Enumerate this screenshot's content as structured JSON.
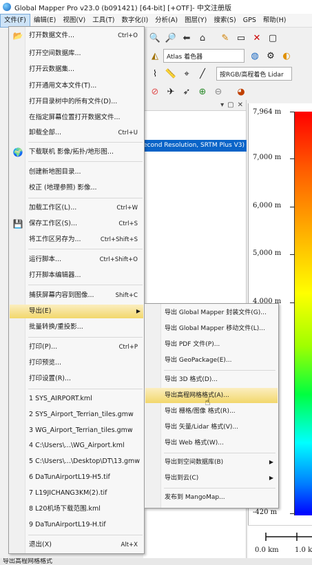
{
  "window": {
    "title": "Global Mapper Pro v23.0 (b091421) [64-bit] [+OTF]- 中文注册版"
  },
  "menubar": [
    {
      "label": "文件(F)",
      "active": true
    },
    {
      "label": "编辑(E)"
    },
    {
      "label": "视图(V)"
    },
    {
      "label": "工具(T)"
    },
    {
      "label": "数字化(I)"
    },
    {
      "label": "分析(A)"
    },
    {
      "label": "图层(Y)"
    },
    {
      "label": "搜索(S)"
    },
    {
      "label": "GPS"
    },
    {
      "label": "帮助(H)"
    }
  ],
  "toolbar": {
    "basemap_select": "Atlas 着色器",
    "shader_select": "按RGB/高程着色 Lidar"
  },
  "layer_panel": {
    "selected_layer": "econd Resolution, SRTM Plus V3)"
  },
  "file_menu": {
    "items": [
      {
        "label": "打开数据文件...",
        "shortcut": "Ctrl+O",
        "icon": "folder-icon"
      },
      {
        "label": "打开空间数据库..."
      },
      {
        "label": "打开云数据集..."
      },
      {
        "label": "打开通用文本文件(T)..."
      },
      {
        "label": "打开目录树中的所有文件(D)..."
      },
      {
        "label": "在指定屏幕位置打开数据文件..."
      },
      {
        "label": "卸载全部...",
        "shortcut": "Ctrl+U"
      },
      {
        "label": "下载联机 影像/拓扑/地形图...",
        "icon": "globe-icon"
      },
      {
        "label": "创建新地图目录..."
      },
      {
        "label": "校正 (地理参照) 影像..."
      },
      {
        "label": "加载工作区(L)...",
        "shortcut": "Ctrl+W"
      },
      {
        "label": "保存工作区(S)...",
        "shortcut": "Ctrl+S",
        "icon": "save-icon"
      },
      {
        "label": "将工作区另存为...",
        "shortcut": "Ctrl+Shift+S"
      },
      {
        "label": "运行脚本...",
        "shortcut": "Ctrl+Shift+O"
      },
      {
        "label": "打开脚本编辑器..."
      },
      {
        "label": "捕获屏幕内容到图像...",
        "shortcut": "Shift+C"
      },
      {
        "label": "导出(E)",
        "submenu": true
      },
      {
        "label": "批量转换/重投影..."
      },
      {
        "label": "打印(P)...",
        "shortcut": "Ctrl+P"
      },
      {
        "label": "打印预览..."
      },
      {
        "label": "打印设置(R)..."
      },
      {
        "label": "1 SYS_AIRPORT.kml"
      },
      {
        "label": "2 SYS_Airport_Terrian_tiles.gmw"
      },
      {
        "label": "3 WG_Airport_Terrian_tiles.gmw"
      },
      {
        "label": "4 C:\\Users\\...\\WG_Airport.kml"
      },
      {
        "label": "5 C:\\Users\\...\\Desktop\\DT\\13.gmw"
      },
      {
        "label": "6 DaTunAirportL19-H5.tif"
      },
      {
        "label": "7 L19JICHANG3KM(2).tif"
      },
      {
        "label": "8 L20机场下载范围.kml"
      },
      {
        "label": "9 DaTunAirportL19-H.tif"
      },
      {
        "label": "退出(X)",
        "shortcut": "Alt+X"
      }
    ]
  },
  "export_submenu": {
    "items": [
      {
        "label": "导出 Global Mapper 封装文件(G)..."
      },
      {
        "label": "导出 Global Mapper 移动文件(L)..."
      },
      {
        "label": "导出 PDF 文件(P)..."
      },
      {
        "label": "导出 GeoPackage(E)..."
      },
      {
        "label": "导出 3D 格式(D)..."
      },
      {
        "label": "导出高程网格格式(A)..."
      },
      {
        "label": "导出 栅格/图像 格式(R)..."
      },
      {
        "label": "导出 矢量/Lidar 格式(V)..."
      },
      {
        "label": "导出 Web 格式(W)..."
      },
      {
        "label": "导出到空间数据库(B)",
        "submenu": true
      },
      {
        "label": "导出到云(C)",
        "submenu": true
      },
      {
        "label": "发布到 MangoMap..."
      }
    ]
  },
  "elevation_legend": {
    "labels": [
      "7,964 m",
      "7,000 m",
      "6,000 m",
      "5,000 m",
      "4,000 m",
      "-420 m"
    ]
  },
  "scale_bar": {
    "labels": [
      "0.0 km",
      "1.0 k"
    ]
  },
  "statusbar": {
    "text": "导出高程网格格式"
  }
}
